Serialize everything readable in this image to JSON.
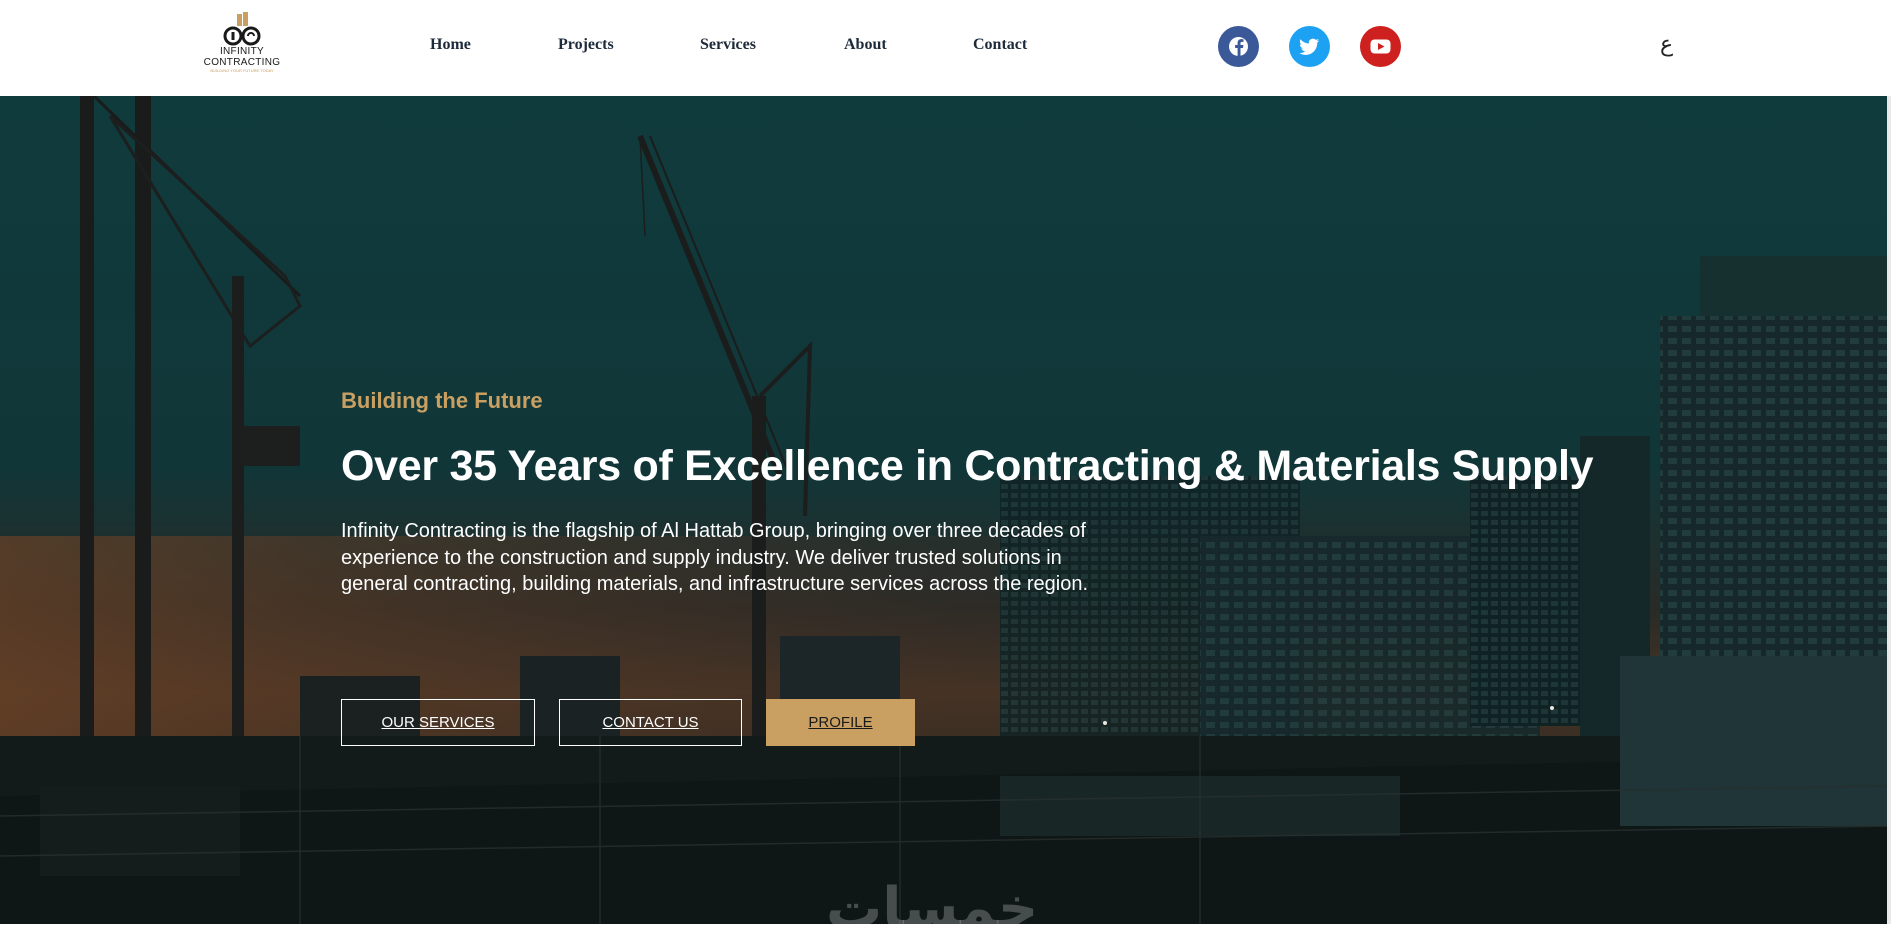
{
  "header": {
    "logo": {
      "line1": "INFINITY",
      "line2": "CONTRACTING",
      "tagline": "BUILDING YOUR FUTURE TODAY"
    },
    "nav": [
      {
        "label": "Home"
      },
      {
        "label": "Projects"
      },
      {
        "label": "Services"
      },
      {
        "label": "About"
      },
      {
        "label": "Contact"
      }
    ],
    "social": [
      {
        "icon": "facebook-icon",
        "color": "#3b5998"
      },
      {
        "icon": "twitter-icon",
        "color": "#1da1f2"
      },
      {
        "icon": "youtube-icon",
        "color": "#cd201f"
      }
    ],
    "language_toggle": "ع"
  },
  "hero": {
    "eyebrow": "Building the Future",
    "headline": "Over 35 Years of Excellence in Contracting & Materials Supply",
    "lead": "Infinity Contracting is the flagship of Al Hattab Group, bringing over three decades of experience to the construction and supply industry. We deliver trusted solutions in general contracting, building materials, and infrastructure services across the region.",
    "buttons": {
      "services": "OUR SERVICES",
      "contact": "CONTACT US",
      "profile": "PROFILE"
    },
    "watermark": "خمسات"
  },
  "colors": {
    "accent_gold": "#c9a062",
    "nav_text": "#1c2a3a",
    "hero_overlay": "#0f3335"
  }
}
